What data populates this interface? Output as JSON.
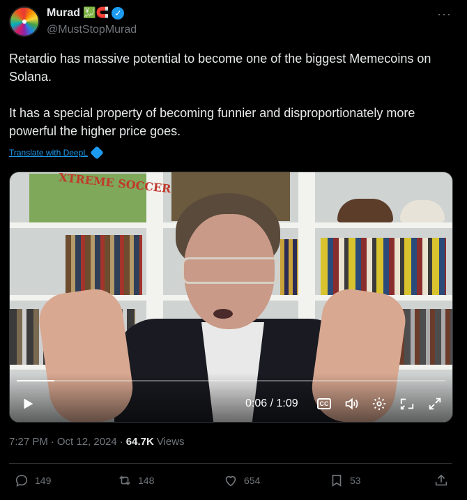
{
  "author": {
    "display_name": "Murad",
    "emojis": "💹🧲",
    "verified_mark": "✓",
    "handle": "@MustStopMurad"
  },
  "menu": {
    "more_label": "···"
  },
  "tweet": {
    "paragraph_1": "Retardio has massive potential to become one of the biggest Memecoins on Solana.",
    "paragraph_2": "It has a special property of becoming funnier and disproportionately more powerful the higher price goes.",
    "translate_label": "Translate with DeepL"
  },
  "video": {
    "current_time": "0:06",
    "duration": "1:09",
    "time_display": "0:06 / 1:09",
    "progress_fraction": 0.087,
    "cc_label": "CC",
    "icons": [
      "play-icon",
      "closed-captions-icon",
      "volume-icon",
      "settings-icon",
      "picture-in-picture-icon",
      "fullscreen-icon"
    ],
    "shelf_sign": "XTREME SOCCER"
  },
  "meta": {
    "time": "7:27 PM",
    "sep": "·",
    "date": "Oct 12, 2024",
    "sep2": "·",
    "views_count": "64.7K",
    "views_label": "Views"
  },
  "actions": {
    "replies": "149",
    "reposts": "148",
    "likes": "654",
    "bookmarks": "53"
  },
  "colors": {
    "background": "#000000",
    "text": "#e7e9ea",
    "muted": "#71767b",
    "accent": "#1d9bf0",
    "border": "#2f3336"
  }
}
